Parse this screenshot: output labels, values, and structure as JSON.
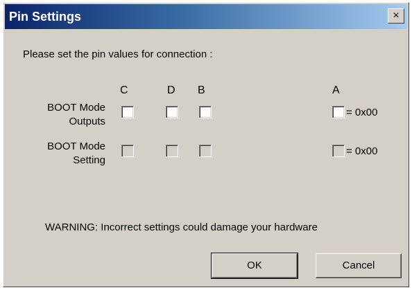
{
  "window": {
    "title": "Pin Settings",
    "close_glyph": "×"
  },
  "prompt": "Please set the pin values for connection :",
  "columns": {
    "c": "C",
    "d": "D",
    "b": "B",
    "a": "A"
  },
  "rows": {
    "outputs": {
      "label_line1": "BOOT Mode",
      "label_line2": "Outputs",
      "hex_value": "= 0x00",
      "checkboxes": {
        "c": false,
        "d": false,
        "b": false,
        "a": false
      },
      "enabled": true
    },
    "setting": {
      "label_line1": "BOOT Mode",
      "label_line2": "Setting",
      "hex_value": "= 0x00",
      "checkboxes": {
        "c": false,
        "d": false,
        "b": false,
        "a": false
      },
      "enabled": false
    }
  },
  "warning": "WARNING: Incorrect settings could damage your hardware",
  "buttons": {
    "ok": "OK",
    "cancel": "Cancel"
  },
  "icons": {
    "close": "close-icon"
  },
  "colors": {
    "titlebar_start": "#0a246a",
    "titlebar_end": "#a6caf0",
    "dialog_bg": "#d4d0c8"
  }
}
